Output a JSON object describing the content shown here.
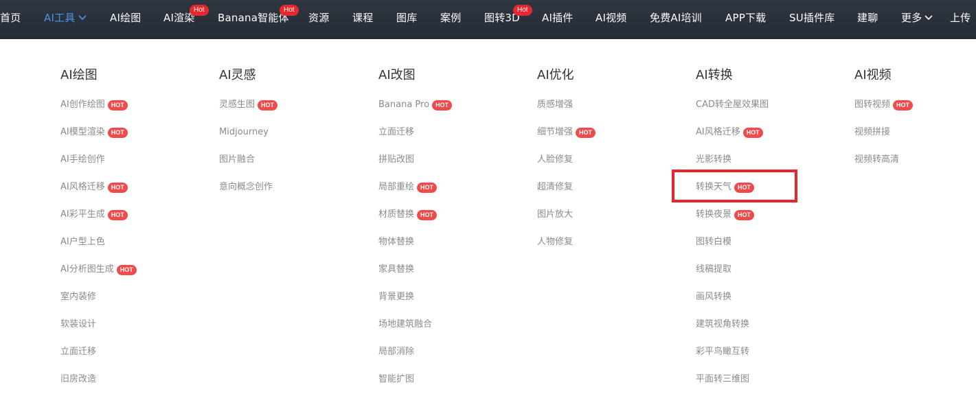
{
  "nav": {
    "items": [
      {
        "label": "首页"
      },
      {
        "label": "AI工具",
        "active": true,
        "chevron": "chevron-down-icon"
      },
      {
        "label": "AI绘图"
      },
      {
        "label": "AI渲染",
        "tag": "Hot"
      },
      {
        "label": "Banana智能体",
        "tag": "Hot"
      },
      {
        "label": "资源"
      },
      {
        "label": "课程"
      },
      {
        "label": "图库"
      },
      {
        "label": "案例"
      },
      {
        "label": "图转3D",
        "tag": "Hot"
      },
      {
        "label": "AI插件"
      },
      {
        "label": "AI视频"
      },
      {
        "label": "免费AI培训"
      },
      {
        "label": "APP下载"
      },
      {
        "label": "SU插件库"
      },
      {
        "label": "建聊"
      },
      {
        "label": "更多",
        "chevron": "chevron-down-icon"
      },
      {
        "label": "上传"
      }
    ]
  },
  "columns": [
    {
      "title": "AI绘图",
      "items": [
        {
          "label": "AI创作绘图",
          "badge": "HOT"
        },
        {
          "label": "AI模型渲染",
          "badge": "HOT"
        },
        {
          "label": "AI手绘创作"
        },
        {
          "label": "AI风格迁移",
          "badge": "HOT"
        },
        {
          "label": "AI彩平生成",
          "badge": "HOT"
        },
        {
          "label": "AI户型上色"
        },
        {
          "label": "AI分析图生成",
          "badge": "HOT"
        },
        {
          "label": "室内装修"
        },
        {
          "label": "软装设计"
        },
        {
          "label": "立面迁移"
        },
        {
          "label": "旧房改造"
        }
      ]
    },
    {
      "title": "AI灵感",
      "items": [
        {
          "label": "灵感生图",
          "badge": "HOT"
        },
        {
          "label": "Midjourney"
        },
        {
          "label": "图片融合"
        },
        {
          "label": "意向概念创作"
        }
      ]
    },
    {
      "title": "AI改图",
      "items": [
        {
          "label": "Banana Pro",
          "badge": "HOT"
        },
        {
          "label": "立面迁移"
        },
        {
          "label": "拼贴改图"
        },
        {
          "label": "局部重绘",
          "badge": "HOT"
        },
        {
          "label": "材质替换",
          "badge": "HOT"
        },
        {
          "label": "物体替换"
        },
        {
          "label": "家具替换"
        },
        {
          "label": "背景更换"
        },
        {
          "label": "场地建筑融合"
        },
        {
          "label": "局部消除"
        },
        {
          "label": "智能扩图"
        }
      ]
    },
    {
      "title": "AI优化",
      "items": [
        {
          "label": "质感增强"
        },
        {
          "label": "细节增强",
          "badge": "HOT"
        },
        {
          "label": "人脸修复"
        },
        {
          "label": "超清修复"
        },
        {
          "label": "图片放大"
        },
        {
          "label": "人物修复"
        }
      ]
    },
    {
      "title": "AI转换",
      "items": [
        {
          "label": "CAD转全屋效果图"
        },
        {
          "label": "AI风格迁移",
          "badge": "HOT"
        },
        {
          "label": "光影转换"
        },
        {
          "label": "转换天气",
          "badge": "HOT"
        },
        {
          "label": "转换夜景",
          "badge": "HOT"
        },
        {
          "label": "图转白模"
        },
        {
          "label": "线稿提取"
        },
        {
          "label": "画风转换"
        },
        {
          "label": "建筑视角转换"
        },
        {
          "label": "彩平鸟瞰互转"
        },
        {
          "label": "平面转三维图"
        }
      ]
    },
    {
      "title": "AI视频",
      "items": [
        {
          "label": "图转视频",
          "badge": "HOT"
        },
        {
          "label": "视频拼接"
        },
        {
          "label": "视频转高清"
        }
      ]
    }
  ],
  "colors": {
    "nav_bg": "#2b323b",
    "nav_active": "#4f93e8",
    "hot_tag": "#e8262f",
    "badge": "#f04a4a",
    "highlight": "#e5272d"
  }
}
